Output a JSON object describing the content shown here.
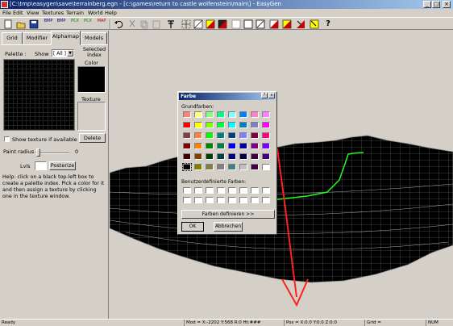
{
  "window": {
    "title": "[C:\\tmp\\easygen\\save\\terrainberg.egn - [c:\\games\\return to castle wolfenstein\\main\\] - EasyGen"
  },
  "menu": [
    "File",
    "Edit",
    "View",
    "Textures",
    "Terrain",
    "World",
    "Help"
  ],
  "toolbar": {
    "bmp1": "BMP",
    "bmp2": "BMP",
    "pcx1": "PCX",
    "pcx2": "PCX",
    "map": "MAP",
    "help": "?"
  },
  "left_panel": {
    "tabs": [
      "Grid",
      "Modifier",
      "Alphamap",
      "Models"
    ],
    "active_tab": "Alphamap",
    "palette_label": "Palette :",
    "show_label": "Show",
    "show_value": "[ All ]",
    "selected_index_label": "Selected index",
    "color_label": "Color",
    "texture_label": "Texture",
    "delete_label": "Delete",
    "show_texture_label": "Show texture if available",
    "paint_radius_label": "Paint radius :",
    "paint_radius_value": "0",
    "lvls_label": "Lvls",
    "posterize_label": "Posterize",
    "help_text": "Help: click on a black top-left box to create a palette index. Pick a color for it and then assign a texture by clicking one in the texture window."
  },
  "dialog": {
    "title": "Farbe",
    "help_btn": "?",
    "close_btn": "x",
    "basic_colors_label": "Grundfarben:",
    "basic_colors": [
      [
        "#ff8080",
        "#ffff80",
        "#80ff80",
        "#00ff80",
        "#80ffff",
        "#0080ff",
        "#ff80c0",
        "#ff80ff"
      ],
      [
        "#ff0000",
        "#ffff00",
        "#80ff00",
        "#00ff40",
        "#00ffff",
        "#0080c0",
        "#8080c0",
        "#ff00ff"
      ],
      [
        "#804040",
        "#ff8040",
        "#00ff00",
        "#008080",
        "#004080",
        "#8080ff",
        "#800040",
        "#ff0080"
      ],
      [
        "#800000",
        "#ff8000",
        "#008000",
        "#008040",
        "#0000ff",
        "#0000a0",
        "#800080",
        "#8000ff"
      ],
      [
        "#400000",
        "#804000",
        "#004000",
        "#004040",
        "#000080",
        "#000040",
        "#400040",
        "#400080"
      ],
      [
        "#000000",
        "#808000",
        "#808040",
        "#808080",
        "#408080",
        "#c0c0c0",
        "#400040",
        "#ffffff"
      ]
    ],
    "custom_colors_label": "Benutzerdefinierte Farben:",
    "define_colors_label": "Farben definieren >>",
    "ok_label": "OK",
    "cancel_label": "Abbrechen"
  },
  "status": {
    "ready": "Ready",
    "mod": "Mod = X:-2202 Y:568 R:0 Ht:###",
    "pos": "Pos = X:0.0 Y:0.0 Z:0.0",
    "grid": "Grid =",
    "num": "NUM"
  },
  "colors": {
    "titlebar_start": "#0a246a",
    "titlebar_end": "#a6caf0",
    "face": "#d4d0c8",
    "axis_red": "#ff2020",
    "path_green": "#20ff20"
  }
}
